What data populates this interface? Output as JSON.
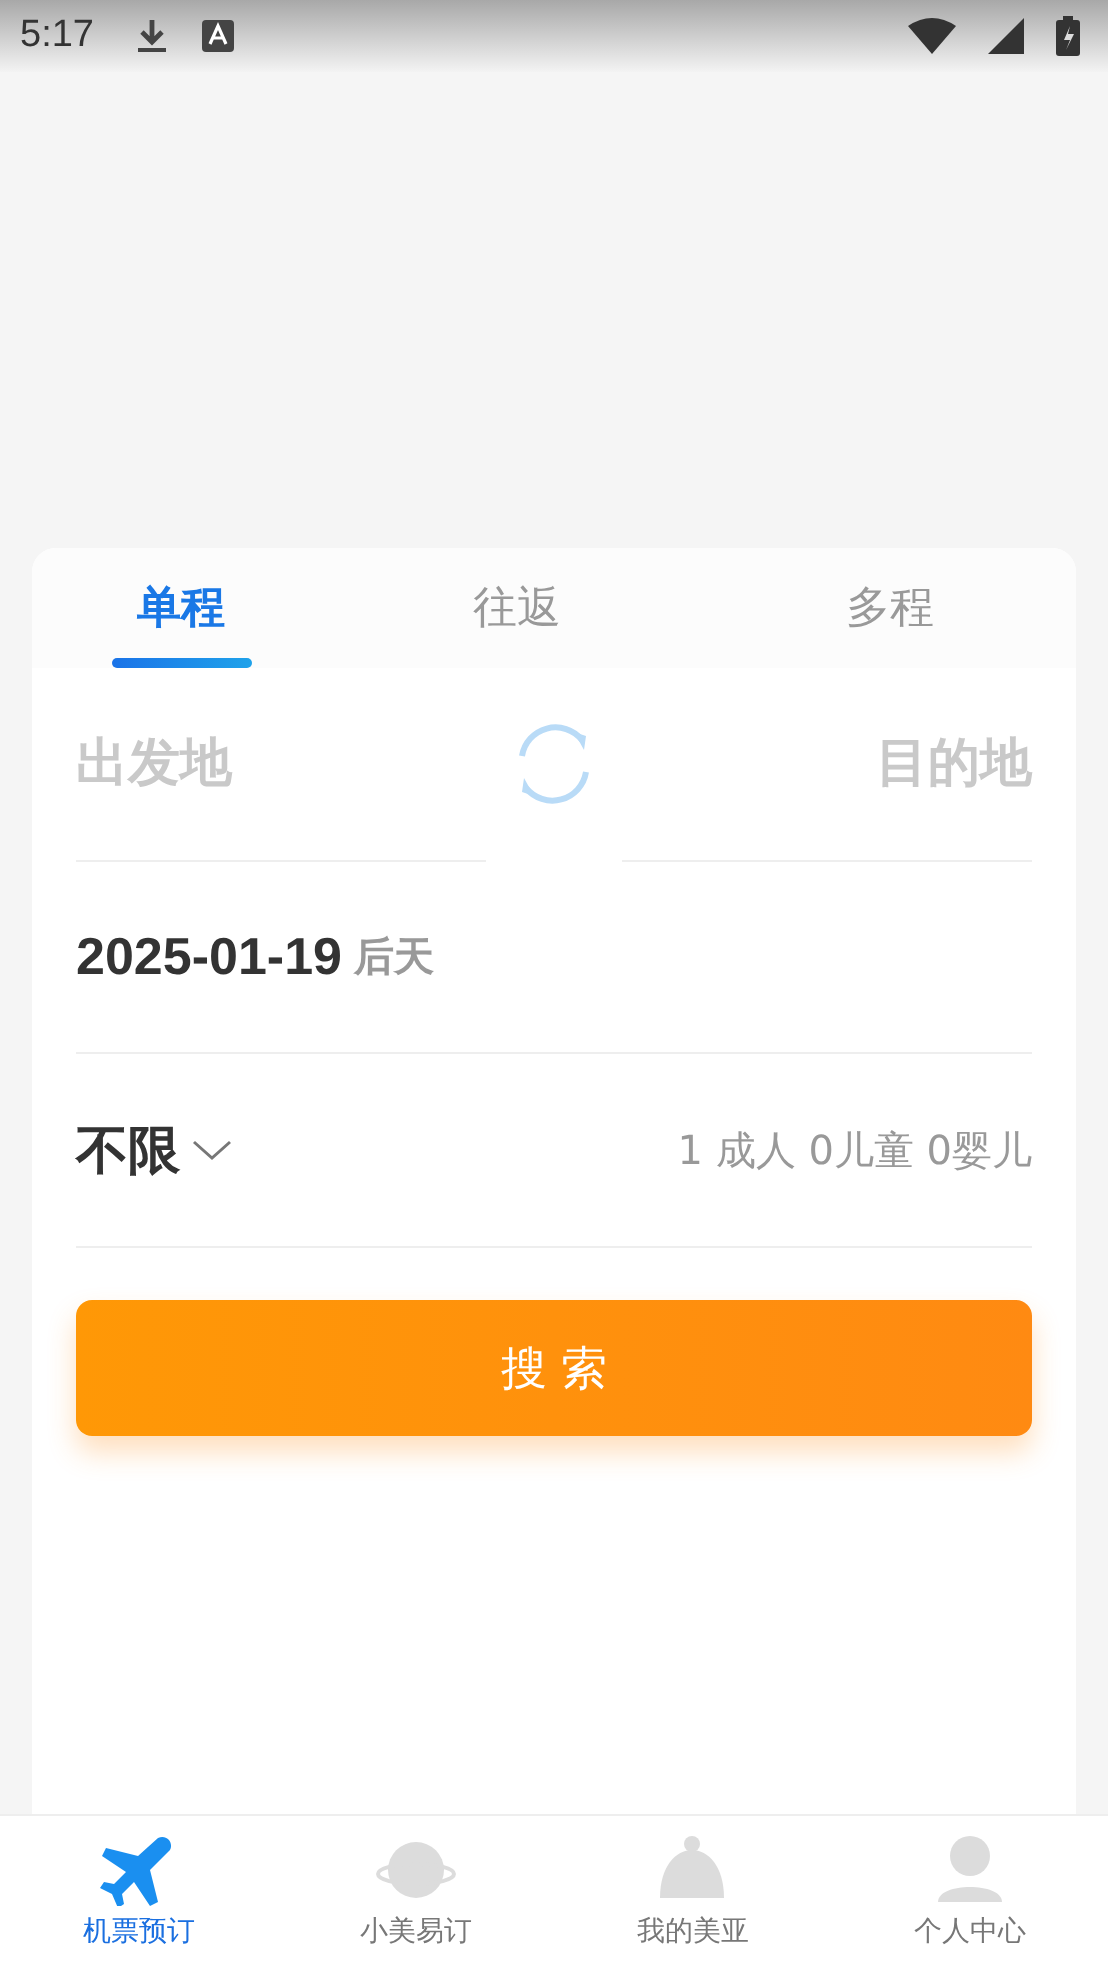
{
  "status_bar": {
    "time": "5:17"
  },
  "tabs": [
    {
      "label": "单程",
      "selected": true
    },
    {
      "label": "往返",
      "selected": false
    },
    {
      "label": "多程",
      "selected": false
    }
  ],
  "route": {
    "from_placeholder": "出发地",
    "to_placeholder": "目的地"
  },
  "date": {
    "value": "2025-01-19",
    "day": "后天"
  },
  "cabin": {
    "value": "不限"
  },
  "passengers": "1 成人 0儿童 0婴儿",
  "search_button": "搜 索",
  "bottom_nav": [
    {
      "label": "机票预订",
      "kind": "plane",
      "selected": true
    },
    {
      "label": "小美易订",
      "kind": "planet",
      "selected": false
    },
    {
      "label": "我的美亚",
      "kind": "bell",
      "selected": false
    },
    {
      "label": "个人中心",
      "kind": "person",
      "selected": false
    }
  ]
}
